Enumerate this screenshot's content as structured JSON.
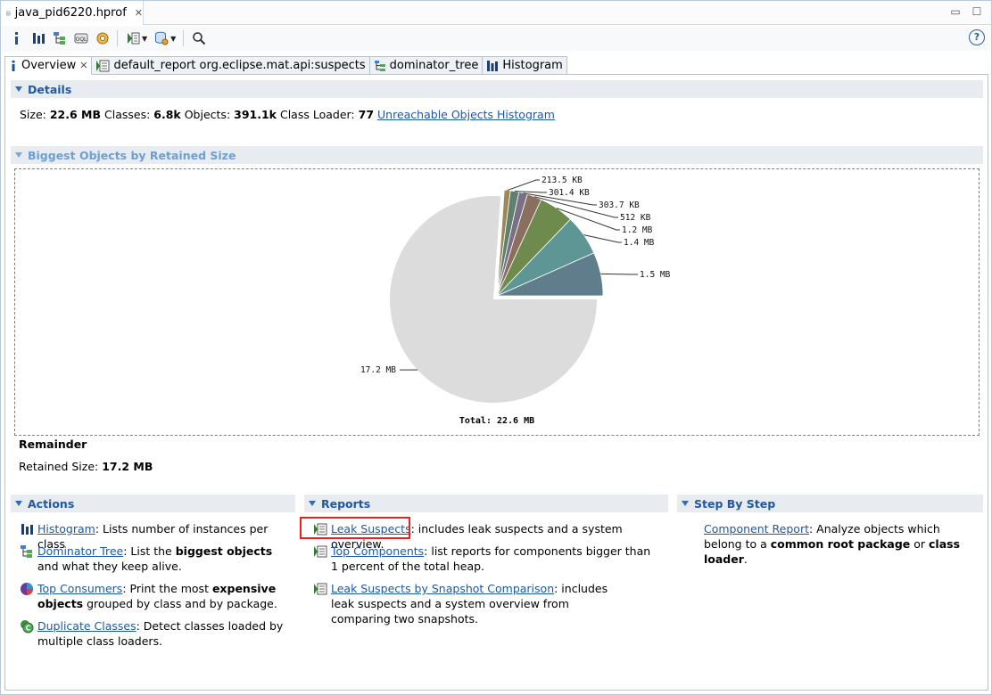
{
  "editor": {
    "file_tab": "java_pid6220.hprof",
    "close_glyph": "✕",
    "minimize_glyph": "▭",
    "maximize_glyph": "☐"
  },
  "toolbar": {
    "items": [
      "info-icon",
      "histogram-icon",
      "dominator-tree-icon",
      "oql-icon",
      "heap-dump-overview-icon",
      "run-report-icon",
      "open-query-browser-icon",
      "search-icon"
    ],
    "help": "?"
  },
  "view_tabs": [
    {
      "label": "Overview",
      "close": "✕"
    },
    {
      "label": "default_report  org.eclipse.mat.api:suspects"
    },
    {
      "label": "dominator_tree"
    },
    {
      "label": "Histogram"
    }
  ],
  "details": {
    "title": "Details",
    "size_label": "Size: ",
    "size_value": "22.6 MB",
    "classes_label": " Classes: ",
    "classes_value": "6.8k",
    "objects_label": " Objects: ",
    "objects_value": "391.1k",
    "loader_label": " Class Loader: ",
    "loader_value": "77",
    "unreachable_link": "Unreachable Objects Histogram"
  },
  "biggest": {
    "title": "Biggest Objects by Retained Size",
    "remainder_title": "Remainder",
    "retained_label": "Retained Size: ",
    "retained_value": "17.2 MB"
  },
  "chart_data": {
    "type": "pie",
    "unit": "MB",
    "total_label": "Total: 22.6 MB",
    "slices": [
      {
        "label": "1.5 MB",
        "value": 1.5,
        "color": "#607d8b"
      },
      {
        "label": "1.4 MB",
        "value": 1.4,
        "color": "#5e9695"
      },
      {
        "label": "1.2 MB",
        "value": 1.2,
        "color": "#6e8a4c"
      },
      {
        "label": "512 KB",
        "value": 0.5,
        "color": "#8a6f5e"
      },
      {
        "label": "303.7 KB",
        "value": 0.2966,
        "color": "#7a6f87"
      },
      {
        "label": "301.4 KB",
        "value": 0.2943,
        "color": "#5f7f6f"
      },
      {
        "label": "213.5 KB",
        "value": 0.2085,
        "color": "#9b8a55"
      },
      {
        "label": "17.2 MB",
        "value": 17.2,
        "color": "#dcdcdc"
      }
    ]
  },
  "actions": {
    "title": "Actions",
    "items": [
      {
        "link": "Histogram",
        "pre": ": Lists number of instances per class",
        "bold": "",
        "post": ""
      },
      {
        "link": "Dominator Tree",
        "pre": ": List the ",
        "bold": "biggest objects",
        "post": " and what they keep alive."
      },
      {
        "link": "Top Consumers",
        "pre": ": Print the most ",
        "bold": "expensive objects",
        "post": " grouped by class and by package."
      },
      {
        "link": "Duplicate Classes",
        "pre": ": Detect classes loaded by multiple class loaders.",
        "bold": "",
        "post": ""
      }
    ]
  },
  "reports": {
    "title": "Reports",
    "items": [
      {
        "link": "Leak Suspects",
        "text": ": includes leak suspects and a system overview."
      },
      {
        "link": "Top Components",
        "text": ": list reports for components bigger than 1 percent of the total heap."
      },
      {
        "link": "Leak Suspects by Snapshot Comparison",
        "text": ": includes leak suspects and a system overview from comparing two snapshots."
      }
    ]
  },
  "steps": {
    "title": "Step By Step",
    "link": "Component Report",
    "pre": ": Analyze objects which belong to a ",
    "bold1": "common root package",
    "mid": " or ",
    "bold2": "class loader",
    "post": "."
  }
}
